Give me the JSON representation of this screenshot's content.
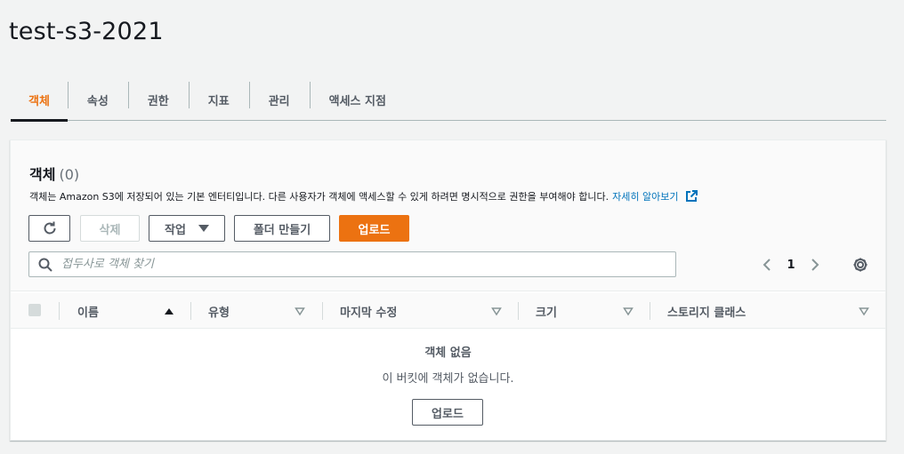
{
  "page": {
    "title": "test-s3-2021"
  },
  "tabs": [
    {
      "label": "객체",
      "active": true
    },
    {
      "label": "속성",
      "active": false
    },
    {
      "label": "권한",
      "active": false
    },
    {
      "label": "지표",
      "active": false
    },
    {
      "label": "관리",
      "active": false
    },
    {
      "label": "액세스 지점",
      "active": false
    }
  ],
  "objects": {
    "title": "객체",
    "count": "(0)",
    "description": "객체는 Amazon S3에 저장되어 있는 기본 엔터티입니다. 다른 사용자가 객체에 액세스할 수 있게 하려면 명시적으로 권한을 부여해야 합니다.",
    "learn_more": "자세히 알아보기",
    "toolbar": {
      "refresh_icon": "refresh-icon",
      "delete_label": "삭제",
      "actions_label": "작업",
      "create_folder_label": "폴더 만들기",
      "upload_label": "업로드"
    },
    "search": {
      "placeholder": "접두사로 객체 찾기",
      "value": ""
    },
    "pagination": {
      "current_page": "1"
    },
    "table": {
      "columns": [
        "이름",
        "유형",
        "마지막 수정",
        "크기",
        "스토리지 클래스"
      ],
      "rows": []
    },
    "empty": {
      "title": "객체 없음",
      "description": "이 버킷에 객체가 없습니다.",
      "upload_label": "업로드"
    }
  },
  "colors": {
    "accent": "#ec7211",
    "link": "#0073bb",
    "text": "#16191f",
    "muted": "#545b64"
  }
}
